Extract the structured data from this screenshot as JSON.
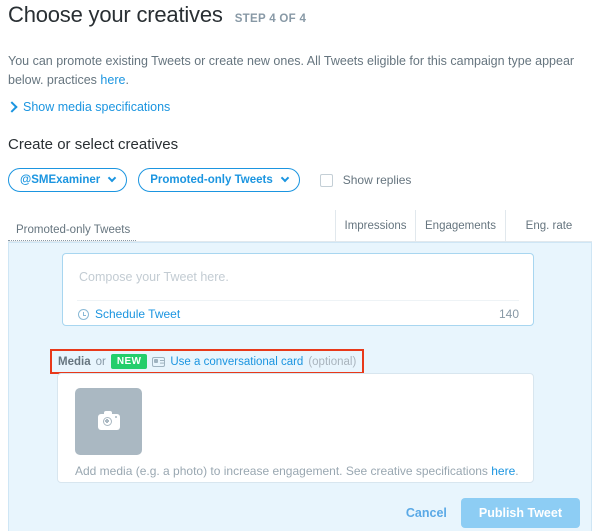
{
  "header": {
    "title": "Choose your creatives",
    "step": "STEP 4 OF 4"
  },
  "intro": {
    "text_before_link": "You can promote existing Tweets or create new ones. All Tweets eligible for this campaign type appear below. practices ",
    "link": "here",
    "text_after_link": "."
  },
  "show_specs": {
    "label": "Show media specifications",
    "icon": "chevron-right-icon"
  },
  "section": {
    "title": "Create or select creatives"
  },
  "filters": {
    "account": "@SMExaminer",
    "tweet_type": "Promoted-only Tweets",
    "show_replies_label": "Show replies",
    "show_replies_checked": false
  },
  "table": {
    "columns": [
      "Promoted-only Tweets",
      "Impressions",
      "Engagements",
      "Eng. rate"
    ]
  },
  "compose": {
    "placeholder": "Compose your Tweet here.",
    "schedule_label": "Schedule Tweet",
    "char_count": "140",
    "clock_icon": "clock-icon"
  },
  "media_label": {
    "media": "Media",
    "or": "or",
    "badge": "NEW",
    "card_icon": "conversational-card-icon",
    "link": "Use a conversational card",
    "optional": "(optional)"
  },
  "media_card": {
    "hint_before_link": "Add media (e.g. a photo) to increase engagement. See creative specifications ",
    "hint_link": "here",
    "hint_after_link": ".",
    "thumb_icon": "camera-add-icon"
  },
  "footer": {
    "cancel": "Cancel",
    "publish": "Publish Tweet"
  },
  "colors": {
    "link_blue": "#1b95e0",
    "panel_blue": "#e8f5fd",
    "badge_green": "#23ce6b",
    "highlight_red": "#e8391a",
    "publish_blue": "#8dcdf4",
    "thumb_gray": "#aab8c2"
  }
}
